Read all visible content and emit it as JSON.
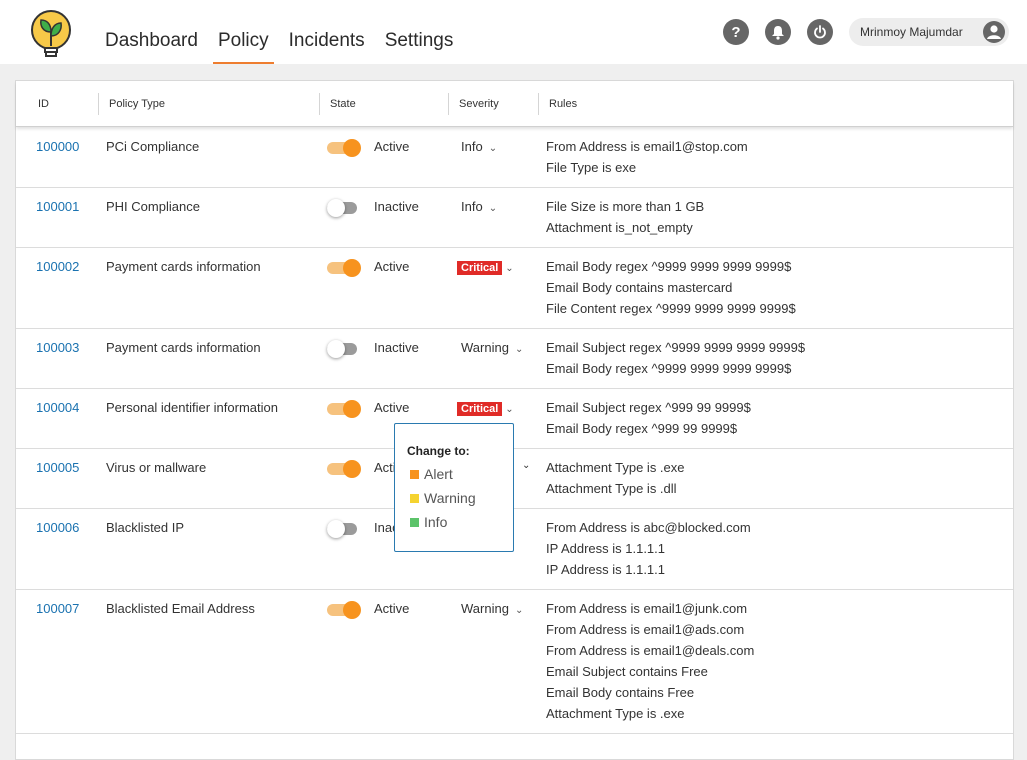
{
  "nav": [
    "Dashboard",
    "Policy",
    "Incidents",
    "Settings"
  ],
  "user": {
    "name": "Mrinmoy Majumdar"
  },
  "icons": {
    "help": "help-icon",
    "bell": "bell-icon",
    "power": "power-icon"
  },
  "colors": {
    "accent": "#f7931e",
    "critical": "#e02b27",
    "link": "#1a72b0",
    "alert": "#f7931e",
    "warning": "#f5d330",
    "info": "#5cc36a"
  },
  "table": {
    "headers": [
      "ID",
      "Policy Type",
      "State",
      "Severity",
      "Rules"
    ],
    "rows": [
      {
        "id": "100000",
        "type": "PCi Compliance",
        "state": "Active",
        "on": true,
        "severity": "Info",
        "critical": false,
        "rules": [
          "From Address is email1@stop.com",
          "File Type is exe"
        ]
      },
      {
        "id": "100001",
        "type": "PHI Compliance",
        "state": "Inactive",
        "on": false,
        "severity": "Info",
        "critical": false,
        "rules": [
          "File Size is more than 1 GB",
          "Attachment is_not_empty"
        ]
      },
      {
        "id": "100002",
        "type": "Payment cards information",
        "state": "Active",
        "on": true,
        "severity": "Critical",
        "critical": true,
        "rules": [
          "Email Body regex ^9999 9999 9999 9999$",
          "Email Body contains mastercard",
          "File Content regex ^9999 9999 9999 9999$"
        ]
      },
      {
        "id": "100003",
        "type": "Payment cards information",
        "state": "Inactive",
        "on": false,
        "severity": "Warning",
        "critical": false,
        "rules": [
          "Email Subject regex ^9999 9999 9999 9999$",
          "Email Body regex ^9999 9999 9999 9999$"
        ]
      },
      {
        "id": "100004",
        "type": "Personal identifier information",
        "state": "Active",
        "on": true,
        "severity": "Critical",
        "critical": true,
        "rules": [
          "Email Subject regex ^999 99 9999$",
          "Email Body regex ^999 99 9999$"
        ]
      },
      {
        "id": "100005",
        "type": "Virus or mallware",
        "state": "Active",
        "on": true,
        "severity": "",
        "critical": false,
        "rules": [
          "Attachment Type is .exe",
          "Attachment Type is .dll"
        ]
      },
      {
        "id": "100006",
        "type": "Blacklisted IP",
        "state": "Inactive",
        "on": false,
        "severity": "",
        "critical": false,
        "rules": [
          "From Address is abc@blocked.com",
          "IP Address is 1.1.1.1",
          "IP Address is 1.1.1.1"
        ]
      },
      {
        "id": "100007",
        "type": "Blacklisted Email Address",
        "state": "Active",
        "on": true,
        "severity": "Warning",
        "critical": false,
        "rules": [
          "From Address is email1@junk.com",
          "From Address is email1@ads.com",
          "From Address is email1@deals.com",
          "Email Subject contains Free",
          "Email Body contains Free",
          "Attachment Type is .exe"
        ]
      }
    ]
  },
  "popup": {
    "title": "Change to:",
    "options": [
      "Alert",
      "Warning",
      "Info"
    ]
  }
}
